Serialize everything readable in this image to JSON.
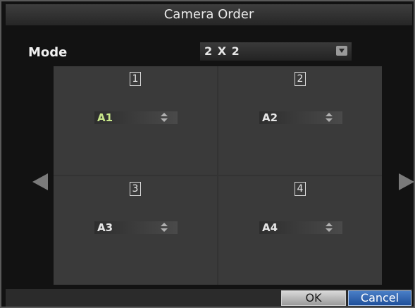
{
  "window": {
    "title": "Camera Order"
  },
  "mode": {
    "label": "Mode",
    "value": "2 X 2"
  },
  "cells": [
    {
      "number": "1",
      "camera": "A1",
      "camera_color": "#c8e68a"
    },
    {
      "number": "2",
      "camera": "A2",
      "camera_color": "#e6e6e6"
    },
    {
      "number": "3",
      "camera": "A3",
      "camera_color": "#e6e6e6"
    },
    {
      "number": "4",
      "camera": "A4",
      "camera_color": "#e6e6e6"
    }
  ],
  "buttons": {
    "ok": "OK",
    "cancel": "Cancel"
  },
  "colors": {
    "accent": "#2f63ad",
    "background": "#121212",
    "panel": "#3a3a3a"
  }
}
